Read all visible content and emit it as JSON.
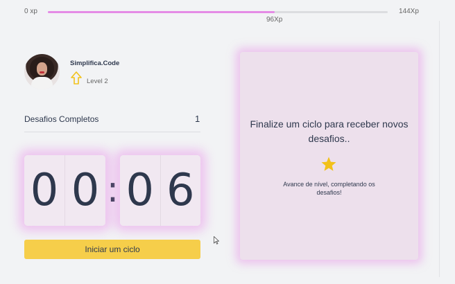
{
  "xp": {
    "min_label": "0 xp",
    "max_label": "144Xp",
    "current_label": "96Xp",
    "current": 96,
    "max": 144
  },
  "profile": {
    "name": "Simplifica.Code",
    "level_label": "Level 2"
  },
  "challenges": {
    "label": "Desafios Completos",
    "count": "1"
  },
  "countdown": {
    "minute_left": "0",
    "minute_right": "0",
    "separator": ":",
    "second_left": "0",
    "second_right": "6"
  },
  "start_button_label": "Iniciar um ciclo",
  "card": {
    "title": "Finalize um ciclo para receber novos desafios..",
    "text": "Avance de nível, completando os desafios!"
  },
  "colors": {
    "accent_pink": "#e58be6",
    "button_yellow": "#f6ce4a",
    "star_gold": "#f2c11a"
  },
  "icons": [
    "level-up-icon",
    "star-icon",
    "mouse-cursor-icon"
  ]
}
